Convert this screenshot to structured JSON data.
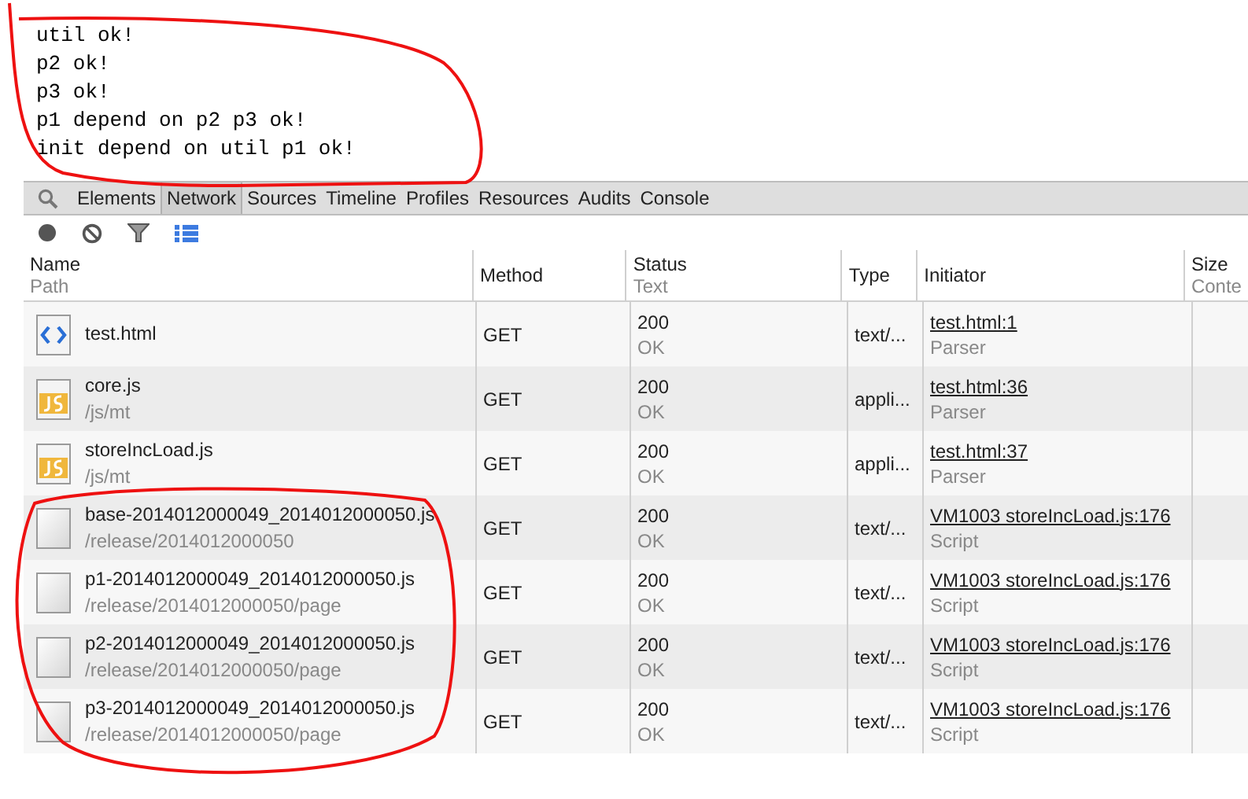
{
  "console_output": [
    "util ok!",
    "p2 ok!",
    "p3 ok!",
    "p1 depend on p2 p3 ok!",
    "init depend on util p1 ok!"
  ],
  "devtools_tabs": [
    {
      "label": "Elements",
      "selected": false
    },
    {
      "label": "Network",
      "selected": true
    },
    {
      "label": "Sources",
      "selected": false
    },
    {
      "label": "Timeline",
      "selected": false
    },
    {
      "label": "Profiles",
      "selected": false
    },
    {
      "label": "Resources",
      "selected": false
    },
    {
      "label": "Audits",
      "selected": false
    },
    {
      "label": "Console",
      "selected": false
    }
  ],
  "table": {
    "columns": [
      {
        "title": "Name",
        "subtitle": "Path"
      },
      {
        "title": "Method"
      },
      {
        "title": "Status",
        "subtitle": "Text"
      },
      {
        "title": "Type"
      },
      {
        "title": "Initiator"
      },
      {
        "title": "Size",
        "subtitle": "Conte"
      }
    ],
    "rows": [
      {
        "kind": "html",
        "name": "test.html",
        "method": "GET",
        "status": "200",
        "status_text": "OK",
        "type": "text/...",
        "initiator": "test.html:1",
        "initiator_type": "Parser"
      },
      {
        "kind": "js",
        "name": "core.js",
        "path": "/js/mt",
        "method": "GET",
        "status": "200",
        "status_text": "OK",
        "type": "appli...",
        "initiator": "test.html:36",
        "initiator_type": "Parser"
      },
      {
        "kind": "js",
        "name": "storeIncLoad.js",
        "path": "/js/mt",
        "method": "GET",
        "status": "200",
        "status_text": "OK",
        "type": "appli...",
        "initiator": "test.html:37",
        "initiator_type": "Parser"
      },
      {
        "kind": "file",
        "name": "base-2014012000049_2014012000050.js",
        "path": "/release/2014012000050",
        "method": "GET",
        "status": "200",
        "status_text": "OK",
        "type": "text/...",
        "initiator": "VM1003 storeIncLoad.js:176",
        "initiator_type": "Script"
      },
      {
        "kind": "file",
        "name": "p1-2014012000049_2014012000050.js",
        "path": "/release/2014012000050/page",
        "method": "GET",
        "status": "200",
        "status_text": "OK",
        "type": "text/...",
        "initiator": "VM1003 storeIncLoad.js:176",
        "initiator_type": "Script"
      },
      {
        "kind": "file",
        "name": "p2-2014012000049_2014012000050.js",
        "path": "/release/2014012000050/page",
        "method": "GET",
        "status": "200",
        "status_text": "OK",
        "type": "text/...",
        "initiator": "VM1003 storeIncLoad.js:176",
        "initiator_type": "Script"
      },
      {
        "kind": "file",
        "name": "p3-2014012000049_2014012000050.js",
        "path": "/release/2014012000050/page",
        "method": "GET",
        "status": "200",
        "status_text": "OK",
        "type": "text/...",
        "initiator": "VM1003 storeIncLoad.js:176",
        "initiator_type": "Script"
      }
    ]
  }
}
